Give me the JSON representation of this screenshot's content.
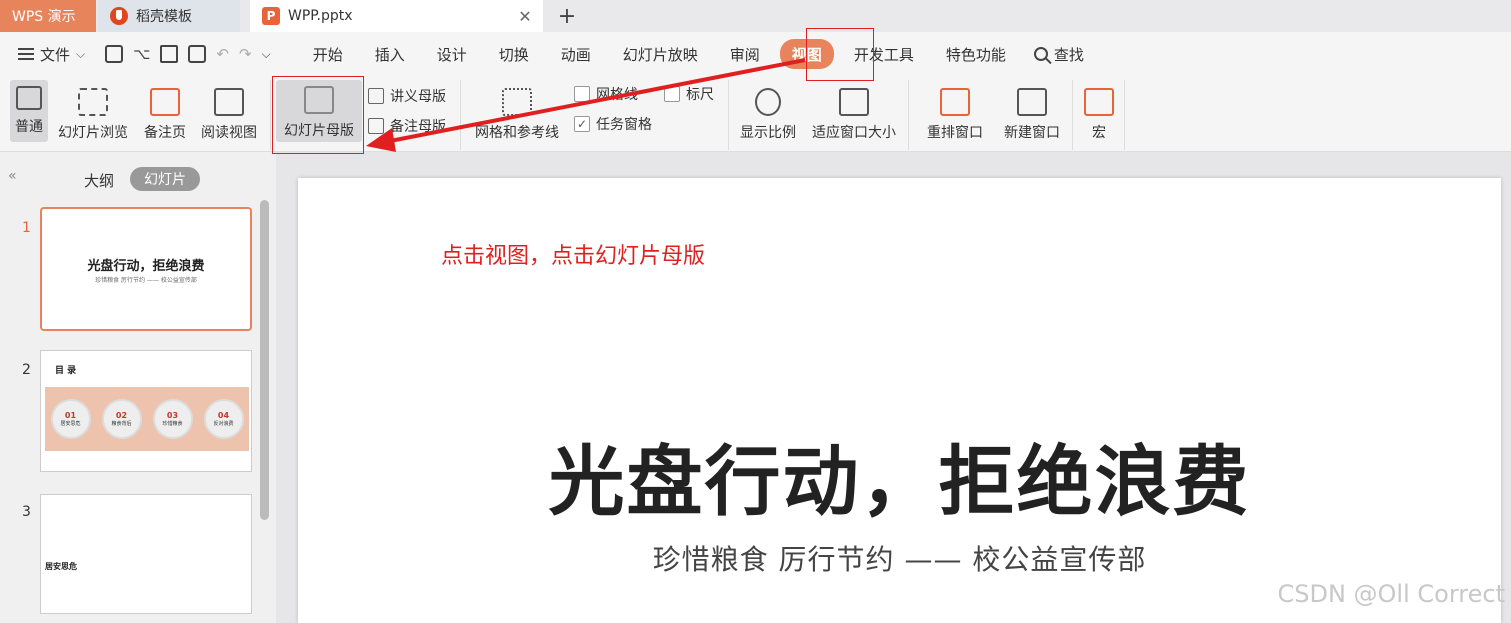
{
  "tabs": {
    "app": "WPS 演示",
    "template": "稻壳模板",
    "file": "WPP.pptx",
    "close": "✕",
    "add": "+"
  },
  "menu": {
    "file": "文件",
    "items": [
      "开始",
      "插入",
      "设计",
      "切换",
      "动画",
      "幻灯片放映",
      "审阅",
      "视图",
      "开发工具",
      "特色功能"
    ],
    "search": "查找"
  },
  "ribbon": {
    "normal": "普通",
    "slide_browse": "幻灯片浏览",
    "notes_page": "备注页",
    "reading_view": "阅读视图",
    "slide_master": "幻灯片母版",
    "handout_master": "讲义母版",
    "notes_master": "备注母版",
    "grid_guides": "网格和参考线",
    "gridlines": "网格线",
    "ruler": "标尺",
    "task_pane": "任务窗格",
    "zoom": "显示比例",
    "fit_window": "适应窗口大小",
    "arrange": "重排窗口",
    "new_window": "新建窗口",
    "macro": "宏"
  },
  "left": {
    "outline": "大纲",
    "slides": "幻灯片",
    "thumbs": [
      {
        "num": "1",
        "title": "光盘行动，拒绝浪费",
        "sub": "珍惜粮食  厉行节约 —— 校公益宣传部"
      },
      {
        "num": "2",
        "title": "目 录",
        "items": [
          {
            "n": "01",
            "t": "居安思危"
          },
          {
            "n": "02",
            "t": "粮食背后"
          },
          {
            "n": "03",
            "t": "珍惜粮食"
          },
          {
            "n": "04",
            "t": "反对浪费"
          }
        ]
      },
      {
        "num": "3",
        "title": "居安思危"
      }
    ]
  },
  "slide": {
    "annotation": "点击视图，点击幻灯片母版",
    "title": "光盘行动，拒绝浪费",
    "subtitle": "珍惜粮食  厉行节约 —— 校公益宣传部"
  },
  "watermark": "CSDN @Oll Correct",
  "colors": {
    "accent": "#e8845c",
    "annotation_red": "#e02020"
  }
}
